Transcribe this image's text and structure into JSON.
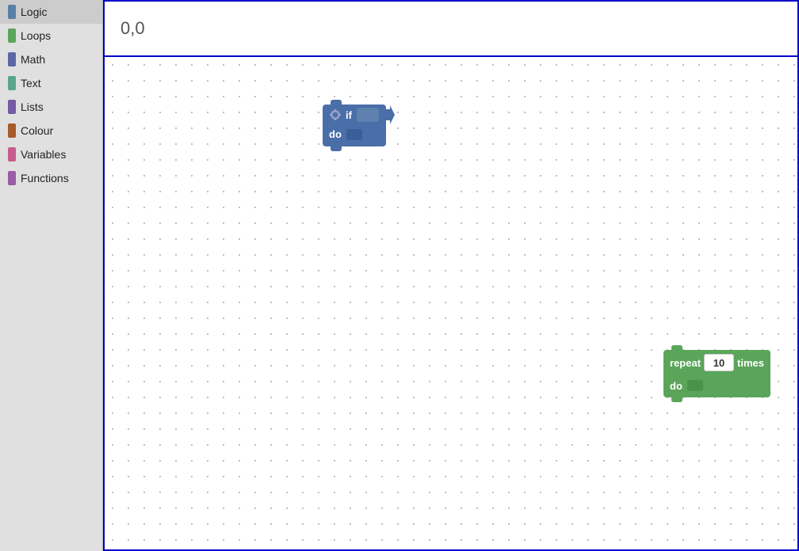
{
  "sidebar": {
    "items": [
      {
        "label": "Logic",
        "color": "#5b80a5",
        "id": "logic"
      },
      {
        "label": "Loops",
        "color": "#5ba55b",
        "id": "loops"
      },
      {
        "label": "Math",
        "color": "#5b67a5",
        "id": "math"
      },
      {
        "label": "Text",
        "color": "#5ba58c",
        "id": "text"
      },
      {
        "label": "Lists",
        "color": "#745ba5",
        "id": "lists"
      },
      {
        "label": "Colour",
        "color": "#a55b5b",
        "id": "colour"
      },
      {
        "label": "Variables",
        "color": "#c45c8c",
        "id": "variables"
      },
      {
        "label": "Functions",
        "color": "#9a5ca6",
        "id": "functions"
      }
    ]
  },
  "header": {
    "coordinates": "0,0"
  },
  "if_block": {
    "label_if": "if",
    "label_do": "do"
  },
  "repeat_block": {
    "label_repeat": "repeat",
    "label_times": "times",
    "label_do": "do",
    "value": "10"
  }
}
